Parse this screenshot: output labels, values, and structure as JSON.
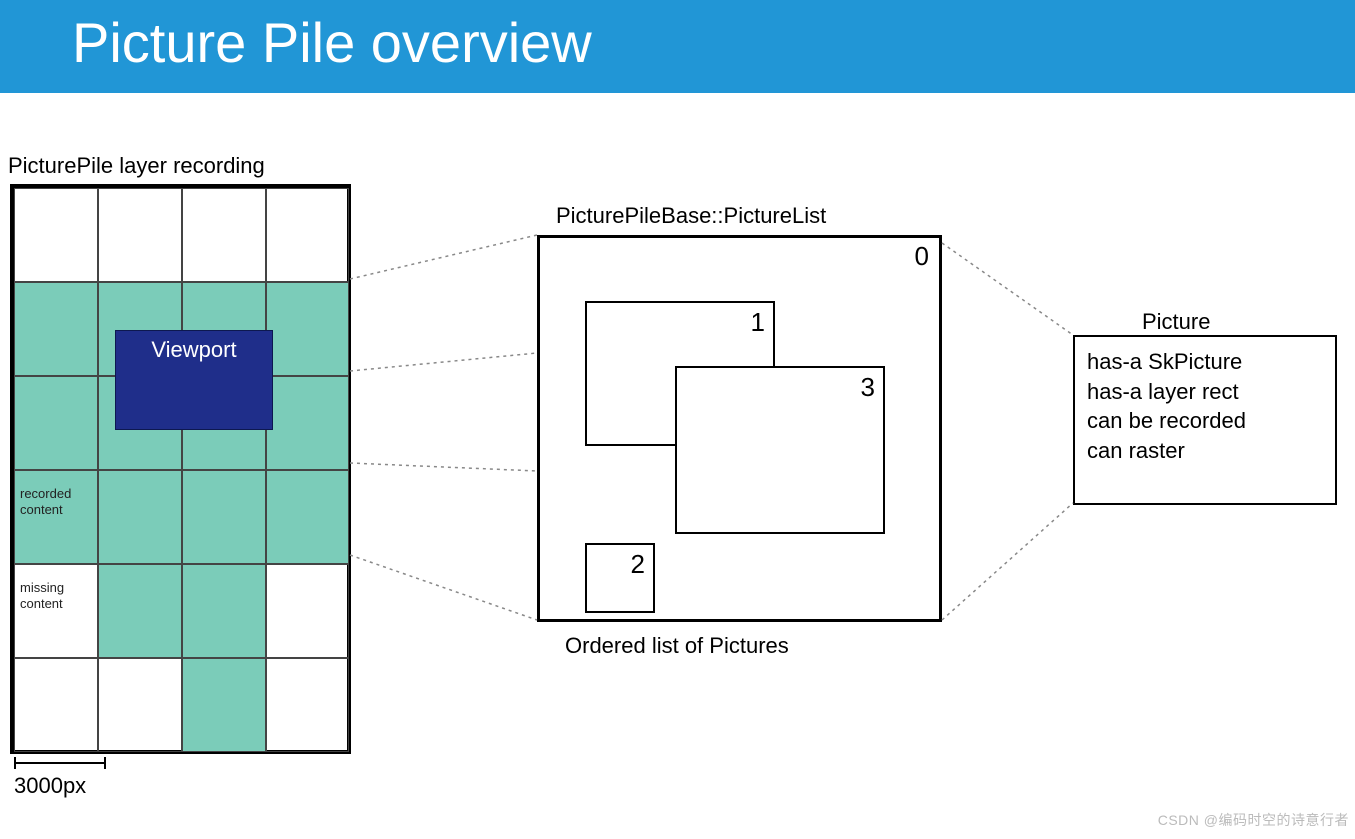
{
  "header": {
    "title": "Picture  Pile overview"
  },
  "left": {
    "title": "PicturePile layer recording",
    "viewport_label": "Viewport",
    "recorded_label": "recorded\ncontent",
    "missing_label": "missing\ncontent",
    "scale_label": "3000px"
  },
  "middle": {
    "title": "PicturePileBase::PictureList",
    "box0": "0",
    "box1": "1",
    "box2": "2",
    "box3": "3",
    "caption": "Ordered list of Pictures"
  },
  "right": {
    "title": "Picture",
    "line1": "has-a SkPicture",
    "line2": "has-a layer rect",
    "line3": "can be recorded",
    "line4": "can raster"
  },
  "watermark": "CSDN @编码时空的诗意行者"
}
